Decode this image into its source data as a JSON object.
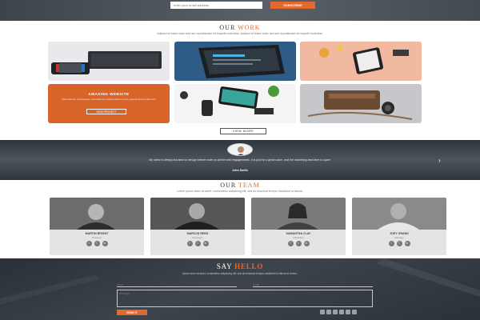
{
  "newsletter": {
    "placeholder": "enter your email address",
    "button": "SUBSCRIBE"
  },
  "work": {
    "title_main": "OUR ",
    "title_accent": "WORK",
    "subtitle": "Adipisci at totam dolor sed aut repudiandae sit impedit molestias. Adipisci at totam dolor sed aut repudiandae sit impedit molestias.",
    "feature": {
      "heading": "AMAZING WEBSITE",
      "text": "Quia dolorem consequatur exercitationem dolores libero minus quaerat assumenda nihil.",
      "button": "VIEW PROJECT"
    },
    "view_more": "VIEW MORE"
  },
  "testimonial": {
    "quote": "My client is deeply focused on design before code on all the web engagements. It is just for a great value, and the marketing lead time is super.",
    "author": "John Smith"
  },
  "team": {
    "title_main": "OUR ",
    "title_accent": "TEAM",
    "subtitle": "Lorem ipsum dolor sit amet, consectetur adipiscing elit, sed do eiusmod tempor incididunt ut labore.",
    "members": [
      {
        "name": "MARTIN BRIGHT",
        "role": "Designer"
      },
      {
        "name": "MARCUS REED",
        "role": "Developer"
      },
      {
        "name": "SAMANTHA CLAY",
        "role": "Marketing"
      },
      {
        "name": "JOEY GRAND",
        "role": "Manager"
      }
    ]
  },
  "contact": {
    "title_main": "SAY ",
    "title_accent": "HELLO",
    "subtitle": "Ipsum dolor sit amet, consectetur adipiscing elit, sed do eiusmod tempor incididunt ut labore et dolore.",
    "name_placeholder": "Name",
    "email_placeholder": "Email",
    "message_placeholder": "Message",
    "send": "SEND IT"
  },
  "colors": {
    "accent": "#e06a2d",
    "dark_band": "#3d444c"
  }
}
